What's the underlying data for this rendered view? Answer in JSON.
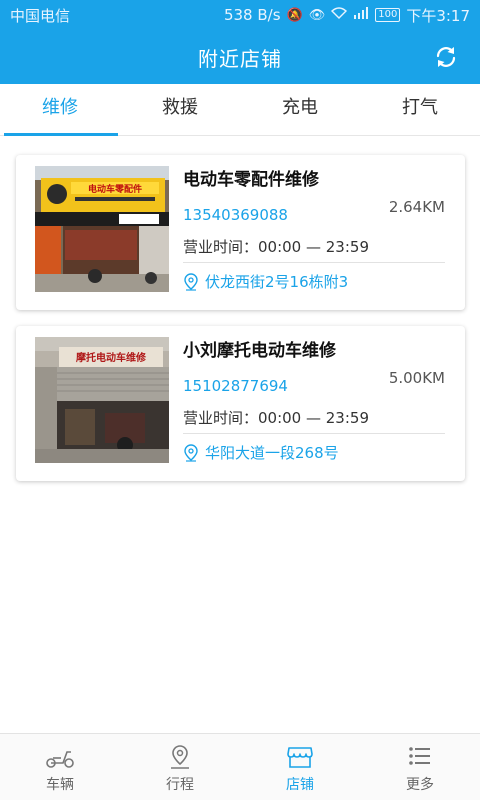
{
  "status_bar": {
    "carrier": "中国电信",
    "net_speed": "538 B/s",
    "battery": "100",
    "time": "下午3:17"
  },
  "header": {
    "title": "附近店铺",
    "refresh_icon": "refresh-icon"
  },
  "tabs": [
    {
      "label": "维修",
      "active": true
    },
    {
      "label": "救援",
      "active": false
    },
    {
      "label": "充电",
      "active": false
    },
    {
      "label": "打气",
      "active": false
    }
  ],
  "shops": [
    {
      "name": "电动车零配件维修",
      "phone": "13540369088",
      "distance": "2.64KM",
      "hours": "营业时间：00:00 — 23:59",
      "address": "伏龙西街2号16栋附3",
      "photo_sign": "电动车零配件"
    },
    {
      "name": "小刘摩托电动车维修",
      "phone": "15102877694",
      "distance": "5.00KM",
      "hours": "营业时间：00:00 — 23:59",
      "address": "华阳大道一段268号",
      "photo_sign": "摩托电动车维修"
    }
  ],
  "bottom_nav": [
    {
      "label": "车辆",
      "icon": "scooter-icon",
      "active": false
    },
    {
      "label": "行程",
      "icon": "location-pin-icon",
      "active": false
    },
    {
      "label": "店铺",
      "icon": "store-icon",
      "active": true
    },
    {
      "label": "更多",
      "icon": "list-icon",
      "active": false
    }
  ],
  "colors": {
    "primary": "#1aa3e8",
    "text": "#333333",
    "nav_inactive": "#666666"
  }
}
